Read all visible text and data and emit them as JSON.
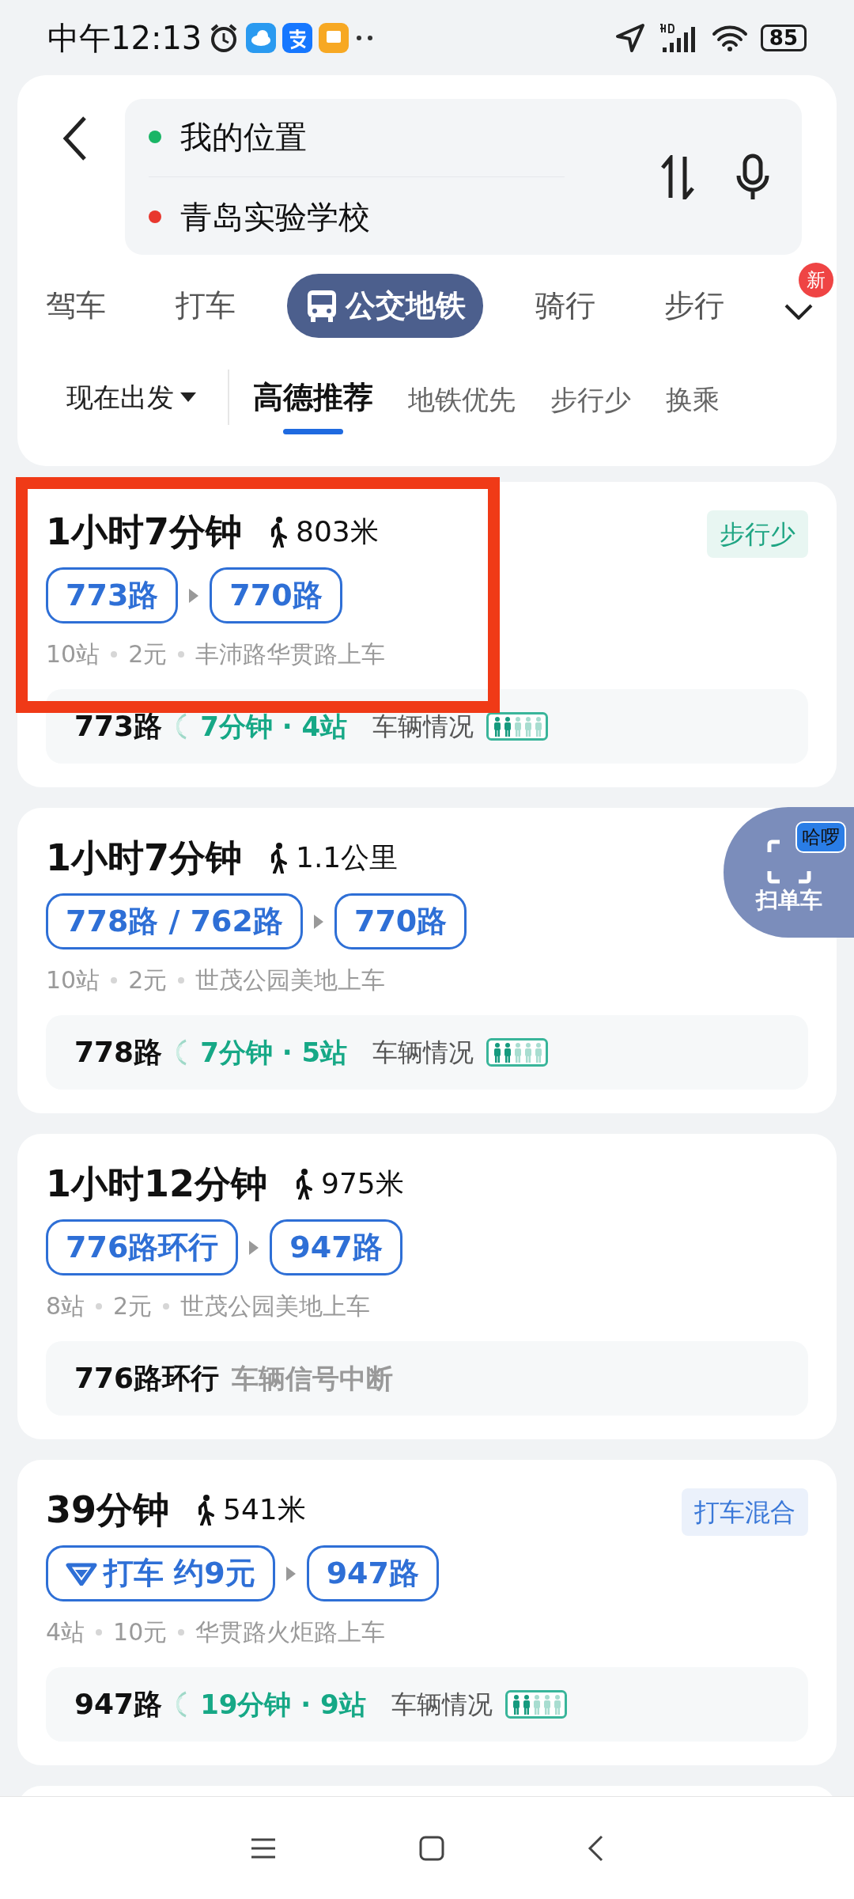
{
  "status_bar": {
    "time": "中午12:13",
    "battery": "85"
  },
  "route": {
    "origin": "我的位置",
    "destination": "青岛实验学校"
  },
  "modes": [
    {
      "label": "驾车",
      "selected": false
    },
    {
      "label": "打车",
      "selected": false
    },
    {
      "label": "公交地铁",
      "selected": true
    },
    {
      "label": "骑行",
      "selected": false
    },
    {
      "label": "步行",
      "selected": false
    }
  ],
  "more_badge": "新",
  "departure": "现在出发",
  "sort_tabs": [
    {
      "label": "高德推荐",
      "selected": true
    },
    {
      "label": "地铁优先",
      "selected": false
    },
    {
      "label": "步行少",
      "selected": false
    },
    {
      "label": "换乘",
      "selected": false
    }
  ],
  "plans": [
    {
      "duration": "1小时7分钟",
      "walk": "803米",
      "highlighted": true,
      "tag": {
        "text": "步行少",
        "color": "#1fa583"
      },
      "segments": [
        {
          "kind": "bus",
          "label": "773路"
        },
        {
          "kind": "bus",
          "label": "770路"
        }
      ],
      "details": [
        "10站",
        "2元",
        "丰沛路华贯路上车"
      ],
      "live": {
        "kind": "live",
        "line": "773路",
        "eta": "7分钟 · 4站",
        "label": "车辆情况"
      }
    },
    {
      "duration": "1小时7分钟",
      "walk": "1.1公里",
      "highlighted": false,
      "segments": [
        {
          "kind": "bus",
          "label": "778路 / 762路"
        },
        {
          "kind": "bus",
          "label": "770路"
        }
      ],
      "details": [
        "10站",
        "2元",
        "世茂公园美地上车"
      ],
      "live": {
        "kind": "live",
        "line": "778路",
        "eta": "7分钟 · 5站",
        "label": "车辆情况"
      }
    },
    {
      "duration": "1小时12分钟",
      "walk": "975米",
      "highlighted": false,
      "segments": [
        {
          "kind": "bus",
          "label": "776路环行"
        },
        {
          "kind": "bus",
          "label": "947路"
        }
      ],
      "details": [
        "8站",
        "2元",
        "世茂公园美地上车"
      ],
      "live": {
        "kind": "no-signal",
        "line": "776路环行",
        "label": "车辆信号中断"
      }
    },
    {
      "duration": "39分钟",
      "walk": "541米",
      "highlighted": false,
      "tag": {
        "text": "打车混合",
        "color": "#3a78d8"
      },
      "segments": [
        {
          "kind": "taxi",
          "label": "打车 约9元"
        },
        {
          "kind": "bus",
          "label": "947路"
        }
      ],
      "details": [
        "4站",
        "10元",
        "华贯路火炬路上车"
      ],
      "live": {
        "kind": "live",
        "line": "947路",
        "eta": "19分钟 · 9站",
        "label": "车辆情况"
      }
    }
  ],
  "bike_button": {
    "label": "扫单车",
    "badge": "哈啰"
  }
}
